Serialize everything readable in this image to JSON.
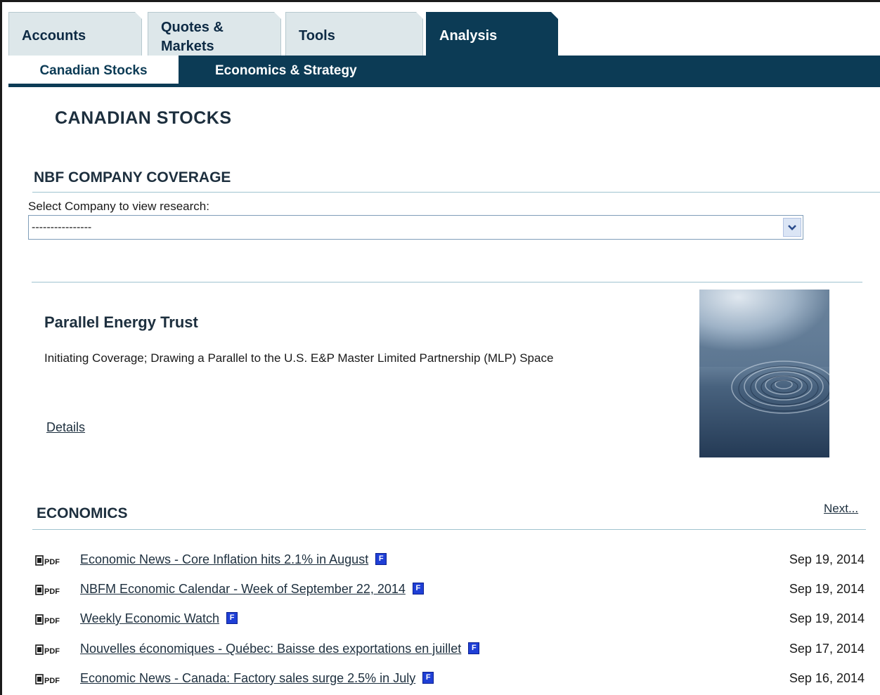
{
  "tabs": [
    {
      "label": "Accounts"
    },
    {
      "label": "Quotes &\nMarkets"
    },
    {
      "label": "Tools"
    },
    {
      "label": "Analysis",
      "active": true
    }
  ],
  "subnav": [
    {
      "label": "Canadian Stocks",
      "active": true
    },
    {
      "label": "Economics & Strategy"
    }
  ],
  "page_title": "CANADIAN STOCKS",
  "coverage": {
    "heading": "NBF COMPANY COVERAGE",
    "select_label": "Select Company to view research:",
    "select_value": "----------------"
  },
  "feature": {
    "title": "Parallel Energy Trust",
    "description": "Initiating Coverage; Drawing a Parallel to the U.S. E&P Master Limited Partnership (MLP) Space",
    "link": "Details"
  },
  "economics": {
    "heading": "ECONOMICS",
    "next": "Next...",
    "pdf_label": "PDF",
    "lang_badge": "F",
    "items": [
      {
        "title": "Economic News - Core Inflation hits 2.1% in August",
        "date": "Sep 19, 2014"
      },
      {
        "title": "NBFM Economic Calendar - Week of September 22, 2014",
        "date": "Sep 19, 2014"
      },
      {
        "title": "Weekly Economic Watch",
        "date": "Sep 19, 2014"
      },
      {
        "title": "Nouvelles économiques - Québec: Baisse des exportations en juillet",
        "date": "Sep 17, 2014"
      },
      {
        "title": "Economic News - Canada: Factory sales surge 2.5% in July",
        "date": "Sep 16, 2014"
      }
    ]
  },
  "colors": {
    "brand_navy": "#0c3b55",
    "tab_inactive": "#dde7ea",
    "rule": "#9fc3cf",
    "badge_blue": "#1f3fd6"
  },
  "icons": [
    "chevron-down-icon",
    "pdf-icon",
    "french-version-icon"
  ]
}
